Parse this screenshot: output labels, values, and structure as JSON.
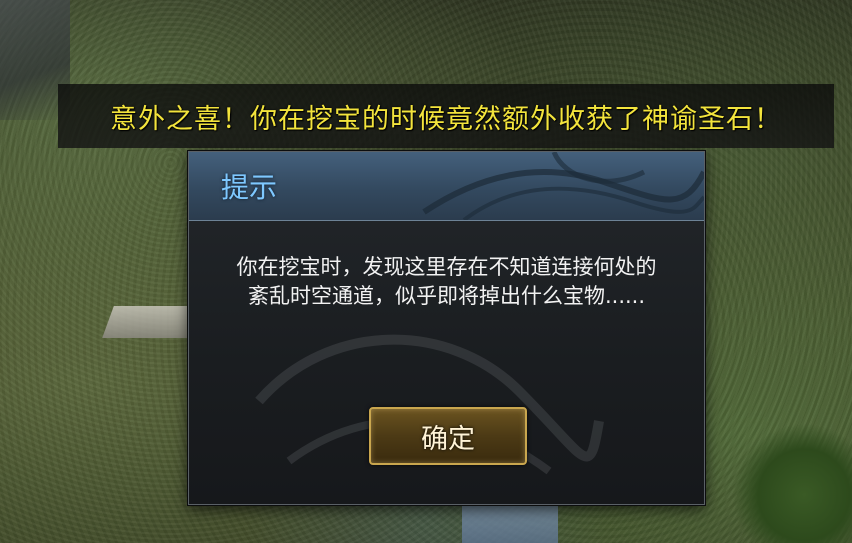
{
  "banner": {
    "text": "意外之喜！你在挖宝的时候竟然额外收获了神谕圣石！"
  },
  "dialog": {
    "title": "提示",
    "message": "你在挖宝时，发现这里存在不知道连接何处的紊乱时空通道，似乎即将掉出什么宝物......",
    "confirm_label": "确定"
  },
  "colors": {
    "banner_text": "#f3e43c",
    "title_text": "#7ec8ff",
    "button_border": "#c9a64e"
  }
}
